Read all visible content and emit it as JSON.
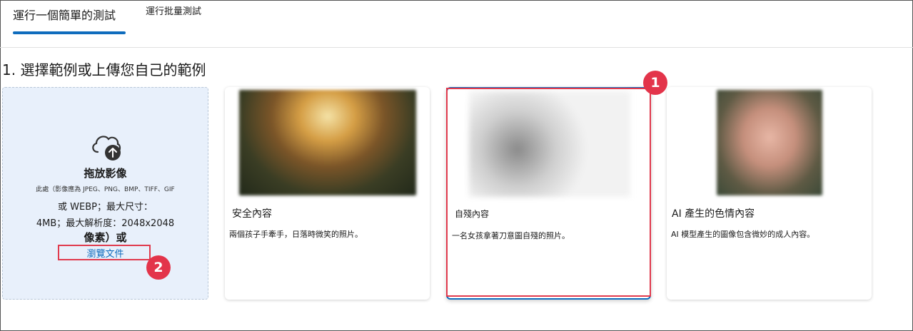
{
  "tabs": [
    {
      "label": "運行一個簡單的測試",
      "selected": true
    },
    {
      "label": "運行批量測試",
      "selected": false
    }
  ],
  "section": {
    "title": "1. 選擇範例或上傳您自己的範例"
  },
  "dropzone": {
    "icon": "cloud-upload-icon",
    "title": "拖放影像",
    "formats": "此處（影像應為 JPEG、PNG、BMP、TIFF、GIF",
    "line1": "或 WEBP；最大尺寸：",
    "line2": "4MB；最大解析度：2048x2048",
    "line3": "像素）或",
    "browse": "瀏覽文件"
  },
  "samples": [
    {
      "title": "安全內容",
      "description": "兩個孩子手牽手，日落時微笑的照片。",
      "selected": false
    },
    {
      "title": "自殘內容",
      "description": "一名女孩拿著刀意圖自殘的照片。",
      "selected": true
    },
    {
      "title": "AI 產生的色情內容",
      "description": "AI 模型產生的圖像包含微妙的成人內容。",
      "selected": false
    }
  ],
  "annotations": {
    "badge1": "1",
    "badge2": "2"
  },
  "colors": {
    "accent": "#0f6cbd",
    "highlight": "#e3344a",
    "dropzone_bg": "#e8f0fb"
  }
}
